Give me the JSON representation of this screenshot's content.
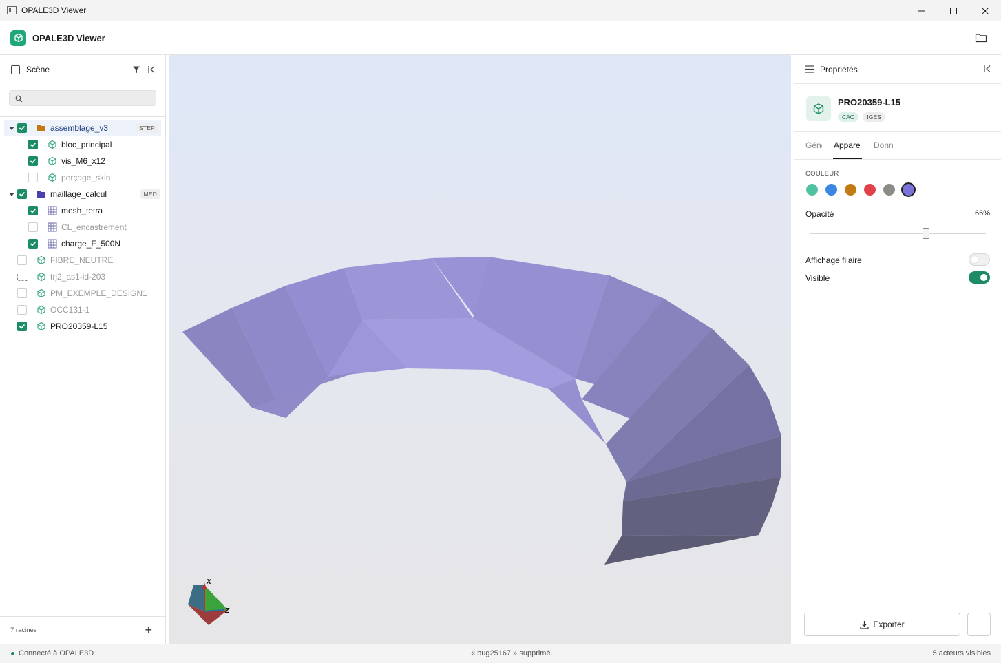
{
  "window": {
    "title": "OPALE3D Viewer"
  },
  "app": {
    "name": "OPALE3D Viewer"
  },
  "scene_panel": {
    "title": "Scène",
    "search_placeholder": "",
    "footer_count": "7 racines",
    "tree": [
      {
        "label": "assemblage_v3",
        "tag": "STEP",
        "checked": true,
        "kind": "folder-orange",
        "level": 0,
        "expanded": true,
        "selected": true
      },
      {
        "label": "bloc_principal",
        "checked": true,
        "kind": "cube",
        "level": 1
      },
      {
        "label": "vis_M6_x12",
        "checked": true,
        "kind": "cube",
        "level": 1
      },
      {
        "label": "perçage_skin",
        "checked": false,
        "kind": "cube",
        "level": 1
      },
      {
        "label": "maillage_calcul",
        "tag": "MED",
        "checked": true,
        "kind": "folder-purple",
        "level": 0,
        "expanded": true
      },
      {
        "label": "mesh_tetra",
        "checked": true,
        "kind": "grid",
        "level": 1
      },
      {
        "label": "CL_encastrement",
        "checked": false,
        "kind": "grid",
        "level": 1
      },
      {
        "label": "charge_F_500N",
        "checked": true,
        "kind": "grid",
        "level": 1
      },
      {
        "label": "FIBRE_NEUTRE",
        "checked": false,
        "kind": "cube",
        "level": 0
      },
      {
        "label": "trj2_as1-id-203",
        "checked": false,
        "kind": "cube",
        "level": 0,
        "dashed_checkbox": true
      },
      {
        "label": "PM_EXEMPLE_DESIGN1",
        "checked": false,
        "kind": "cube",
        "level": 0
      },
      {
        "label": "OCC131-1",
        "checked": false,
        "kind": "cube",
        "level": 0
      },
      {
        "label": "PRO20359-L15",
        "checked": true,
        "kind": "cube",
        "level": 0
      }
    ]
  },
  "viewport": {
    "axes": {
      "x": "X",
      "z": "Z"
    }
  },
  "properties": {
    "title": "Propriétés",
    "object_name": "PRO20359-L15",
    "badges": [
      "CAO",
      "IGES"
    ],
    "tabs": [
      "Géné",
      "Appare",
      "Donn"
    ],
    "active_tab": 1,
    "color_label": "COULEUR",
    "colors": [
      "#4fc3a1",
      "#3a86e0",
      "#c47a14",
      "#e0414b",
      "#8c8c86",
      "#7b73d8"
    ],
    "selected_color": 5,
    "opacity_label": "Opacité",
    "opacity_value": "66%",
    "opacity": 0.66,
    "wireframe_label": "Affichage filaire",
    "wireframe": false,
    "visible_label": "Visible",
    "visible": true,
    "export_label": "Exporter"
  },
  "status": {
    "connection": "Connecté à OPALE3D",
    "message": "« bug25167 » supprimé.",
    "actors": "5  acteurs visibles"
  }
}
